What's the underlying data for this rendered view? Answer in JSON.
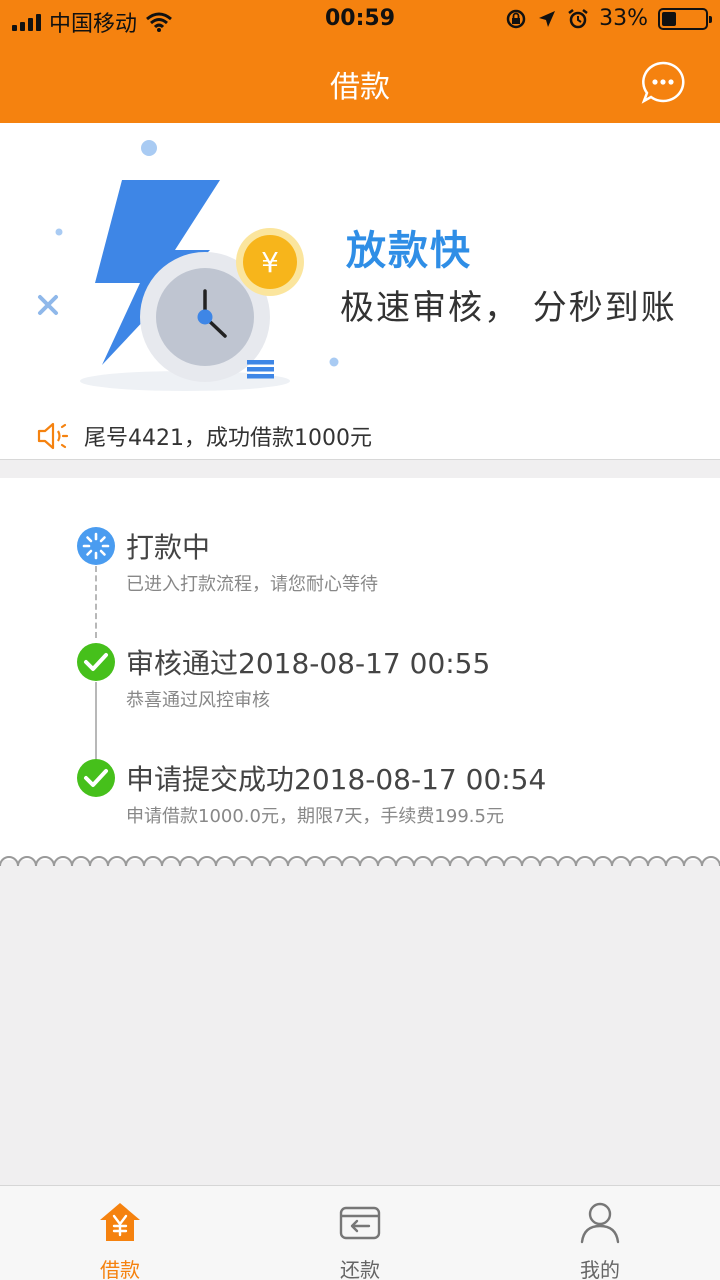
{
  "status_bar": {
    "carrier": "中国移动",
    "time": "00:59",
    "battery_percent": "33%",
    "battery_level": 0.33,
    "icons": [
      "signal-icon",
      "wifi-icon",
      "orientation-lock-icon",
      "location-icon",
      "alarm-icon",
      "battery-icon"
    ]
  },
  "nav": {
    "title": "借款",
    "more_icon": "more-chat-icon"
  },
  "banner": {
    "headline": "放款快",
    "subline": "极速审核， 分秒到账",
    "coin_symbol": "¥",
    "notice_icon": "speaker-icon",
    "notice": "尾号4421，成功借款1000元"
  },
  "timeline": [
    {
      "status": "processing",
      "icon": "loading-icon",
      "title": "打款中",
      "desc": "已进入打款流程，请您耐心等待"
    },
    {
      "status": "done",
      "icon": "check-icon",
      "title": "审核通过2018-08-17 00:55",
      "desc": "恭喜通过风控审核"
    },
    {
      "status": "done",
      "icon": "check-icon",
      "title": "申请提交成功2018-08-17 00:54",
      "desc": "申请借款1000.0元，期限7天，手续费199.5元"
    }
  ],
  "tabbar": {
    "tabs": [
      {
        "label": "借款",
        "icon": "home-yen-icon",
        "active": true
      },
      {
        "label": "还款",
        "icon": "card-return-icon",
        "active": false
      },
      {
        "label": "我的",
        "icon": "user-icon",
        "active": false
      }
    ]
  },
  "colors": {
    "primary": "#f5820f",
    "headline_blue": "#2f8ee6",
    "success_green": "#46c01b",
    "processing_blue": "#4a9cf0"
  }
}
